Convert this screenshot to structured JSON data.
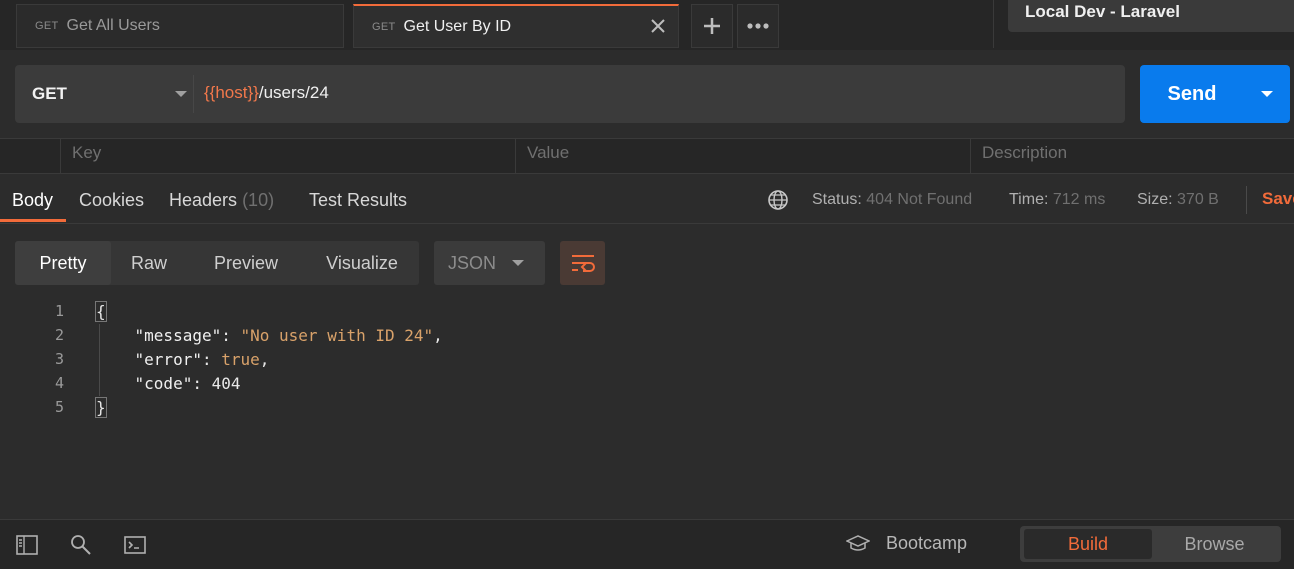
{
  "tabs": [
    {
      "method": "GET",
      "label": "Get All Users"
    },
    {
      "method": "GET",
      "label": "Get User By ID"
    }
  ],
  "environment": "Local Dev - Laravel",
  "request": {
    "method": "GET",
    "url_variable": "{{host}}",
    "url_path": "/users/24",
    "send_label": "Send"
  },
  "params": {
    "key": "Key",
    "value": "Value",
    "description": "Description"
  },
  "response_tabs": {
    "body": "Body",
    "cookies": "Cookies",
    "headers": "Headers",
    "headers_count": "(10)",
    "test_results": "Test Results"
  },
  "status": {
    "status_label": "Status:",
    "status_value": "404 Not Found",
    "time_label": "Time:",
    "time_value": "712 ms",
    "size_label": "Size:",
    "size_value": "370 B",
    "save_label": "Save"
  },
  "view": {
    "pretty": "Pretty",
    "raw": "Raw",
    "preview": "Preview",
    "visualize": "Visualize",
    "format": "JSON"
  },
  "code": {
    "line_numbers": [
      "1",
      "2",
      "3",
      "4",
      "5"
    ],
    "open_brace": "{",
    "message_key": "\"message\"",
    "message_value": "\"No user with ID 24\"",
    "error_key": "\"error\"",
    "error_value": "true",
    "code_key": "\"code\"",
    "code_value": "404",
    "close_brace": "}"
  },
  "footer": {
    "bootcamp": "Bootcamp",
    "build": "Build",
    "browse": "Browse"
  },
  "colors": {
    "accent": "#f26b3a",
    "send": "#097bed",
    "string": "#d9a26a"
  }
}
